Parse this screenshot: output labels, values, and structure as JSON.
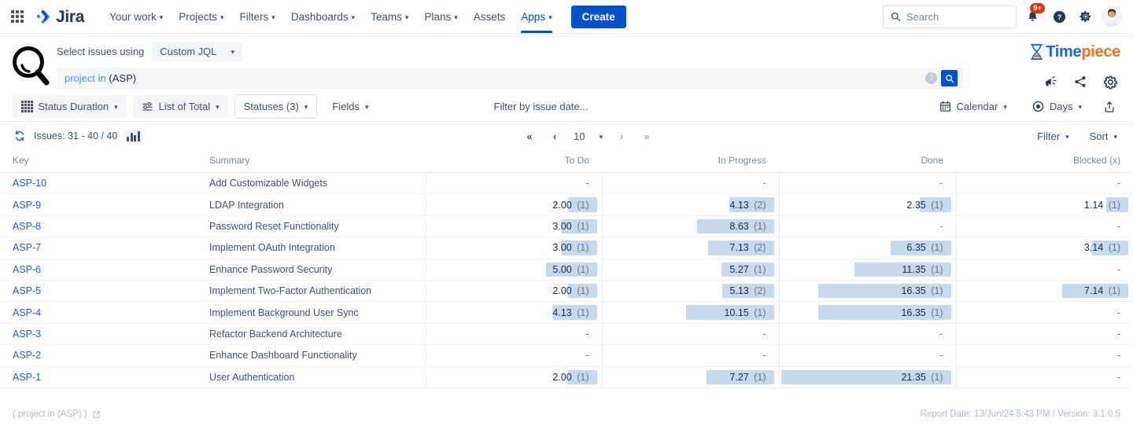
{
  "nav": {
    "app_switcher": "app-switcher-icon",
    "logo_text": "Jira",
    "items": [
      {
        "label": "Your work",
        "has_caret": true
      },
      {
        "label": "Projects",
        "has_caret": true
      },
      {
        "label": "Filters",
        "has_caret": true
      },
      {
        "label": "Dashboards",
        "has_caret": true
      },
      {
        "label": "Teams",
        "has_caret": true
      },
      {
        "label": "Plans",
        "has_caret": true
      },
      {
        "label": "Assets",
        "has_caret": false
      },
      {
        "label": "Apps",
        "has_caret": true
      }
    ],
    "create_label": "Create",
    "search_placeholder": "Search",
    "notification_badge": "9+",
    "icons": [
      "notifications-icon",
      "help-icon",
      "settings-icon",
      "avatar"
    ]
  },
  "app_header": {
    "magnifier_icon": "magnifier-icon",
    "select_label": "Select issues using",
    "jql_mode": "Custom JQL",
    "jql_query": {
      "keyword": "project",
      "operator": "in",
      "value": "(ASP)"
    },
    "help_icon": "help-icon",
    "go_icon": "search-icon",
    "brand": {
      "first": "Time",
      "second": "piece",
      "icon": "hourglass-icon"
    },
    "actions": [
      "megaphone-icon",
      "share-icon",
      "gear-icon"
    ]
  },
  "toolbar": {
    "view_button": "Status Duration",
    "list_button": "List of Total",
    "statuses_button": "Statuses (3)",
    "fields_button": "Fields",
    "date_filter_placeholder": "Filter by issue date...",
    "calendar_button": "Calendar",
    "units_button": "Days",
    "export_icon": "export-icon"
  },
  "issues_bar": {
    "refresh_icon": "refresh-icon",
    "count_text": "Issues: 31 - 40 / 40",
    "chart_icon": "bar-chart-icon",
    "page_size": "10",
    "first_icon": "«",
    "prev_icon": "‹",
    "next_icon": "›",
    "last_icon": "»",
    "filter_label": "Filter",
    "sort_label": "Sort"
  },
  "table": {
    "columns": [
      "Key",
      "Summary",
      "To Do",
      "In Progress",
      "Done",
      "Blocked (x)"
    ],
    "bar_color": "#C7DAED",
    "link_color": "#1D62C9",
    "max_value": 21.35,
    "rows": [
      {
        "key": "ASP-10",
        "summary": "Add Customizable Widgets",
        "todo": {
          "value": "-",
          "count": ""
        },
        "inprogress": {
          "value": "-",
          "count": ""
        },
        "done": {
          "value": "-",
          "count": ""
        },
        "blocked": {
          "value": "-",
          "count": ""
        }
      },
      {
        "key": "ASP-9",
        "summary": "LDAP Integration",
        "todo": {
          "value": "2.00",
          "count": "(1)"
        },
        "inprogress": {
          "value": "4.13",
          "count": "(2)"
        },
        "done": {
          "value": "2.35",
          "count": "(1)"
        },
        "blocked": {
          "value": "1.14",
          "count": "(1)"
        }
      },
      {
        "key": "ASP-8",
        "summary": "Password Reset Functionality",
        "todo": {
          "value": "3.00",
          "count": "(1)"
        },
        "inprogress": {
          "value": "8.63",
          "count": "(1)"
        },
        "done": {
          "value": "-",
          "count": ""
        },
        "blocked": {
          "value": "-",
          "count": ""
        }
      },
      {
        "key": "ASP-7",
        "summary": "Implement OAuth Integration",
        "todo": {
          "value": "3.00",
          "count": "(1)"
        },
        "inprogress": {
          "value": "7.13",
          "count": "(2)"
        },
        "done": {
          "value": "6.35",
          "count": "(1)"
        },
        "blocked": {
          "value": "3.14",
          "count": "(1)"
        }
      },
      {
        "key": "ASP-6",
        "summary": "Enhance Password Security",
        "todo": {
          "value": "5.00",
          "count": "(1)"
        },
        "inprogress": {
          "value": "5.27",
          "count": "(1)"
        },
        "done": {
          "value": "11.35",
          "count": "(1)"
        },
        "blocked": {
          "value": "-",
          "count": ""
        }
      },
      {
        "key": "ASP-5",
        "summary": "Implement Two-Factor Authentication",
        "todo": {
          "value": "2.00",
          "count": "(1)"
        },
        "inprogress": {
          "value": "5.13",
          "count": "(2)"
        },
        "done": {
          "value": "16.35",
          "count": "(1)"
        },
        "blocked": {
          "value": "7.14",
          "count": "(1)"
        }
      },
      {
        "key": "ASP-4",
        "summary": "Implement Background User Sync",
        "todo": {
          "value": "4.13",
          "count": "(1)"
        },
        "inprogress": {
          "value": "10.15",
          "count": "(1)"
        },
        "done": {
          "value": "16.35",
          "count": "(1)"
        },
        "blocked": {
          "value": "-",
          "count": ""
        }
      },
      {
        "key": "ASP-3",
        "summary": "Refactor Backend Architecture",
        "todo": {
          "value": "-",
          "count": ""
        },
        "inprogress": {
          "value": "-",
          "count": ""
        },
        "done": {
          "value": "-",
          "count": ""
        },
        "blocked": {
          "value": "-",
          "count": ""
        }
      },
      {
        "key": "ASP-2",
        "summary": "Enhance Dashboard Functionality",
        "todo": {
          "value": "-",
          "count": ""
        },
        "inprogress": {
          "value": "-",
          "count": ""
        },
        "done": {
          "value": "-",
          "count": ""
        },
        "blocked": {
          "value": "-",
          "count": ""
        }
      },
      {
        "key": "ASP-1",
        "summary": "User Authentication",
        "todo": {
          "value": "2.00",
          "count": "(1)"
        },
        "inprogress": {
          "value": "7.27",
          "count": "(1)"
        },
        "done": {
          "value": "21.35",
          "count": "(1)"
        },
        "blocked": {
          "value": "-",
          "count": ""
        }
      }
    ]
  },
  "footer": {
    "query_text": "( project in (ASP) )",
    "external_icon": "external-link-icon",
    "report_info": "Report Date: 13/Jun/24 5:43 PM / Version: 3.1.0.5"
  }
}
